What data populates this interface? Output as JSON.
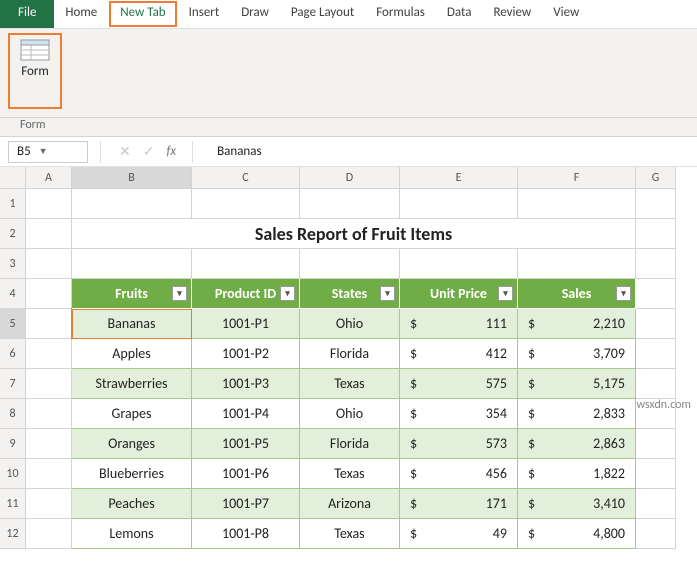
{
  "ribbon": {
    "tabs": [
      "File",
      "Home",
      "New Tab",
      "Insert",
      "Draw",
      "Page Layout",
      "Formulas",
      "Data",
      "Review",
      "View"
    ],
    "active": "New Tab",
    "highlighted": "New Tab",
    "group": {
      "button": "Form",
      "label": "Form"
    }
  },
  "namebox": "B5",
  "formula": "Bananas",
  "columns": [
    "A",
    "B",
    "C",
    "D",
    "E",
    "F",
    "G"
  ],
  "title": "Sales Report of Fruit Items",
  "headers": [
    "Fruits",
    "Product ID",
    "States",
    "Unit Price",
    "Sales"
  ],
  "rows": [
    {
      "fruit": "Bananas",
      "pid": "1001-P1",
      "state": "Ohio",
      "price": "111",
      "sales": "2,210",
      "band": true,
      "sel": true
    },
    {
      "fruit": "Apples",
      "pid": "1001-P2",
      "state": "Florida",
      "price": "412",
      "sales": "3,709",
      "band": false
    },
    {
      "fruit": "Strawberries",
      "pid": "1001-P3",
      "state": "Texas",
      "price": "575",
      "sales": "5,175",
      "band": true
    },
    {
      "fruit": "Grapes",
      "pid": "1001-P4",
      "state": "Ohio",
      "price": "354",
      "sales": "2,833",
      "band": false
    },
    {
      "fruit": "Oranges",
      "pid": "1001-P5",
      "state": "Florida",
      "price": "573",
      "sales": "2,863",
      "band": true
    },
    {
      "fruit": "Blueberries",
      "pid": "1001-P6",
      "state": "Texas",
      "price": "456",
      "sales": "1,822",
      "band": false
    },
    {
      "fruit": "Peaches",
      "pid": "1001-P7",
      "state": "Arizona",
      "price": "171",
      "sales": "3,410",
      "band": true
    },
    {
      "fruit": "Lemons",
      "pid": "1001-P8",
      "state": "Texas",
      "price": "49",
      "sales": "4,800",
      "band": false
    }
  ],
  "currency": "$",
  "watermark": "wsxdn.com",
  "chart_data": {
    "type": "table",
    "title": "Sales Report of Fruit Items",
    "columns": [
      "Fruits",
      "Product ID",
      "States",
      "Unit Price",
      "Sales"
    ],
    "data": [
      [
        "Bananas",
        "1001-P1",
        "Ohio",
        111,
        2210
      ],
      [
        "Apples",
        "1001-P2",
        "Florida",
        412,
        3709
      ],
      [
        "Strawberries",
        "1001-P3",
        "Texas",
        575,
        5175
      ],
      [
        "Grapes",
        "1001-P4",
        "Ohio",
        354,
        2833
      ],
      [
        "Oranges",
        "1001-P5",
        "Florida",
        573,
        2863
      ],
      [
        "Blueberries",
        "1001-P6",
        "Texas",
        456,
        1822
      ],
      [
        "Peaches",
        "1001-P7",
        "Arizona",
        171,
        3410
      ],
      [
        "Lemons",
        "1001-P8",
        "Texas",
        49,
        4800
      ]
    ]
  }
}
